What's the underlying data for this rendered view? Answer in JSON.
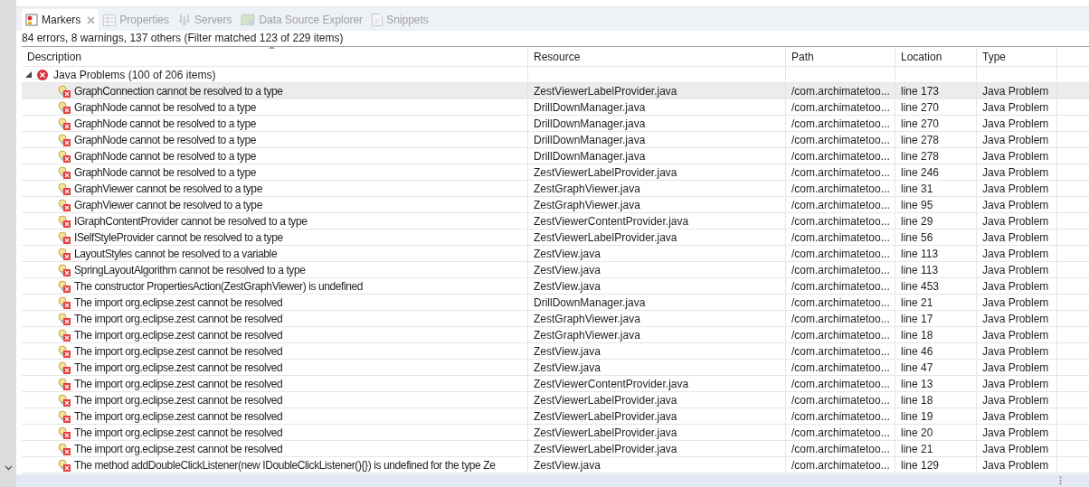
{
  "tabs": [
    {
      "label": "Markers",
      "selected": true,
      "closable": true,
      "kind": "markers"
    },
    {
      "label": "Properties",
      "selected": false,
      "kind": "properties"
    },
    {
      "label": "Servers",
      "selected": false,
      "kind": "servers"
    },
    {
      "label": "Data Source Explorer",
      "selected": false,
      "kind": "datasource"
    },
    {
      "label": "Snippets",
      "selected": false,
      "kind": "snippets"
    }
  ],
  "summary": "84 errors, 8 warnings, 137 others (Filter matched 123 of 229 items)",
  "table": {
    "columns": [
      "Description",
      "Resource",
      "Path",
      "Location",
      "Type"
    ],
    "group": {
      "label": "Java Problems (100 of 206 items)",
      "expanded": true
    },
    "rows": [
      {
        "description": "GraphConnection cannot be resolved to a type",
        "resource": "ZestViewerLabelProvider.java",
        "path": "/com.archimatetoo...",
        "location": "line 173",
        "type": "Java Problem",
        "selected": true
      },
      {
        "description": "GraphNode cannot be resolved to a type",
        "resource": "DrillDownManager.java",
        "path": "/com.archimatetoo...",
        "location": "line 270",
        "type": "Java Problem",
        "selected": false
      },
      {
        "description": "GraphNode cannot be resolved to a type",
        "resource": "DrillDownManager.java",
        "path": "/com.archimatetoo...",
        "location": "line 270",
        "type": "Java Problem",
        "selected": false
      },
      {
        "description": "GraphNode cannot be resolved to a type",
        "resource": "DrillDownManager.java",
        "path": "/com.archimatetoo...",
        "location": "line 278",
        "type": "Java Problem",
        "selected": false
      },
      {
        "description": "GraphNode cannot be resolved to a type",
        "resource": "DrillDownManager.java",
        "path": "/com.archimatetoo...",
        "location": "line 278",
        "type": "Java Problem",
        "selected": false
      },
      {
        "description": "GraphNode cannot be resolved to a type",
        "resource": "ZestViewerLabelProvider.java",
        "path": "/com.archimatetoo...",
        "location": "line 246",
        "type": "Java Problem",
        "selected": false
      },
      {
        "description": "GraphViewer cannot be resolved to a type",
        "resource": "ZestGraphViewer.java",
        "path": "/com.archimatetoo...",
        "location": "line 31",
        "type": "Java Problem",
        "selected": false
      },
      {
        "description": "GraphViewer cannot be resolved to a type",
        "resource": "ZestGraphViewer.java",
        "path": "/com.archimatetoo...",
        "location": "line 95",
        "type": "Java Problem",
        "selected": false
      },
      {
        "description": "IGraphContentProvider cannot be resolved to a type",
        "resource": "ZestViewerContentProvider.java",
        "path": "/com.archimatetoo...",
        "location": "line 29",
        "type": "Java Problem",
        "selected": false
      },
      {
        "description": "ISelfStyleProvider cannot be resolved to a type",
        "resource": "ZestViewerLabelProvider.java",
        "path": "/com.archimatetoo...",
        "location": "line 56",
        "type": "Java Problem",
        "selected": false
      },
      {
        "description": "LayoutStyles cannot be resolved to a variable",
        "resource": "ZestView.java",
        "path": "/com.archimatetoo...",
        "location": "line 113",
        "type": "Java Problem",
        "selected": false
      },
      {
        "description": "SpringLayoutAlgorithm cannot be resolved to a type",
        "resource": "ZestView.java",
        "path": "/com.archimatetoo...",
        "location": "line 113",
        "type": "Java Problem",
        "selected": false
      },
      {
        "description": "The constructor PropertiesAction(ZestGraphViewer) is undefined",
        "resource": "ZestView.java",
        "path": "/com.archimatetoo...",
        "location": "line 453",
        "type": "Java Problem",
        "selected": false
      },
      {
        "description": "The import org.eclipse.zest cannot be resolved",
        "resource": "DrillDownManager.java",
        "path": "/com.archimatetoo...",
        "location": "line 21",
        "type": "Java Problem",
        "selected": false
      },
      {
        "description": "The import org.eclipse.zest cannot be resolved",
        "resource": "ZestGraphViewer.java",
        "path": "/com.archimatetoo...",
        "location": "line 17",
        "type": "Java Problem",
        "selected": false
      },
      {
        "description": "The import org.eclipse.zest cannot be resolved",
        "resource": "ZestGraphViewer.java",
        "path": "/com.archimatetoo...",
        "location": "line 18",
        "type": "Java Problem",
        "selected": false
      },
      {
        "description": "The import org.eclipse.zest cannot be resolved",
        "resource": "ZestView.java",
        "path": "/com.archimatetoo...",
        "location": "line 46",
        "type": "Java Problem",
        "selected": false
      },
      {
        "description": "The import org.eclipse.zest cannot be resolved",
        "resource": "ZestView.java",
        "path": "/com.archimatetoo...",
        "location": "line 47",
        "type": "Java Problem",
        "selected": false
      },
      {
        "description": "The import org.eclipse.zest cannot be resolved",
        "resource": "ZestViewerContentProvider.java",
        "path": "/com.archimatetoo...",
        "location": "line 13",
        "type": "Java Problem",
        "selected": false
      },
      {
        "description": "The import org.eclipse.zest cannot be resolved",
        "resource": "ZestViewerLabelProvider.java",
        "path": "/com.archimatetoo...",
        "location": "line 18",
        "type": "Java Problem",
        "selected": false
      },
      {
        "description": "The import org.eclipse.zest cannot be resolved",
        "resource": "ZestViewerLabelProvider.java",
        "path": "/com.archimatetoo...",
        "location": "line 19",
        "type": "Java Problem",
        "selected": false
      },
      {
        "description": "The import org.eclipse.zest cannot be resolved",
        "resource": "ZestViewerLabelProvider.java",
        "path": "/com.archimatetoo...",
        "location": "line 20",
        "type": "Java Problem",
        "selected": false
      },
      {
        "description": "The import org.eclipse.zest cannot be resolved",
        "resource": "ZestViewerLabelProvider.java",
        "path": "/com.archimatetoo...",
        "location": "line 21",
        "type": "Java Problem",
        "selected": false
      },
      {
        "description": "The method addDoubleClickListener(new IDoubleClickListener(){}) is undefined for the type Ze",
        "resource": "ZestView.java",
        "path": "/com.archimatetoo...",
        "location": "line 129",
        "type": "Java Problem",
        "selected": false
      }
    ]
  }
}
